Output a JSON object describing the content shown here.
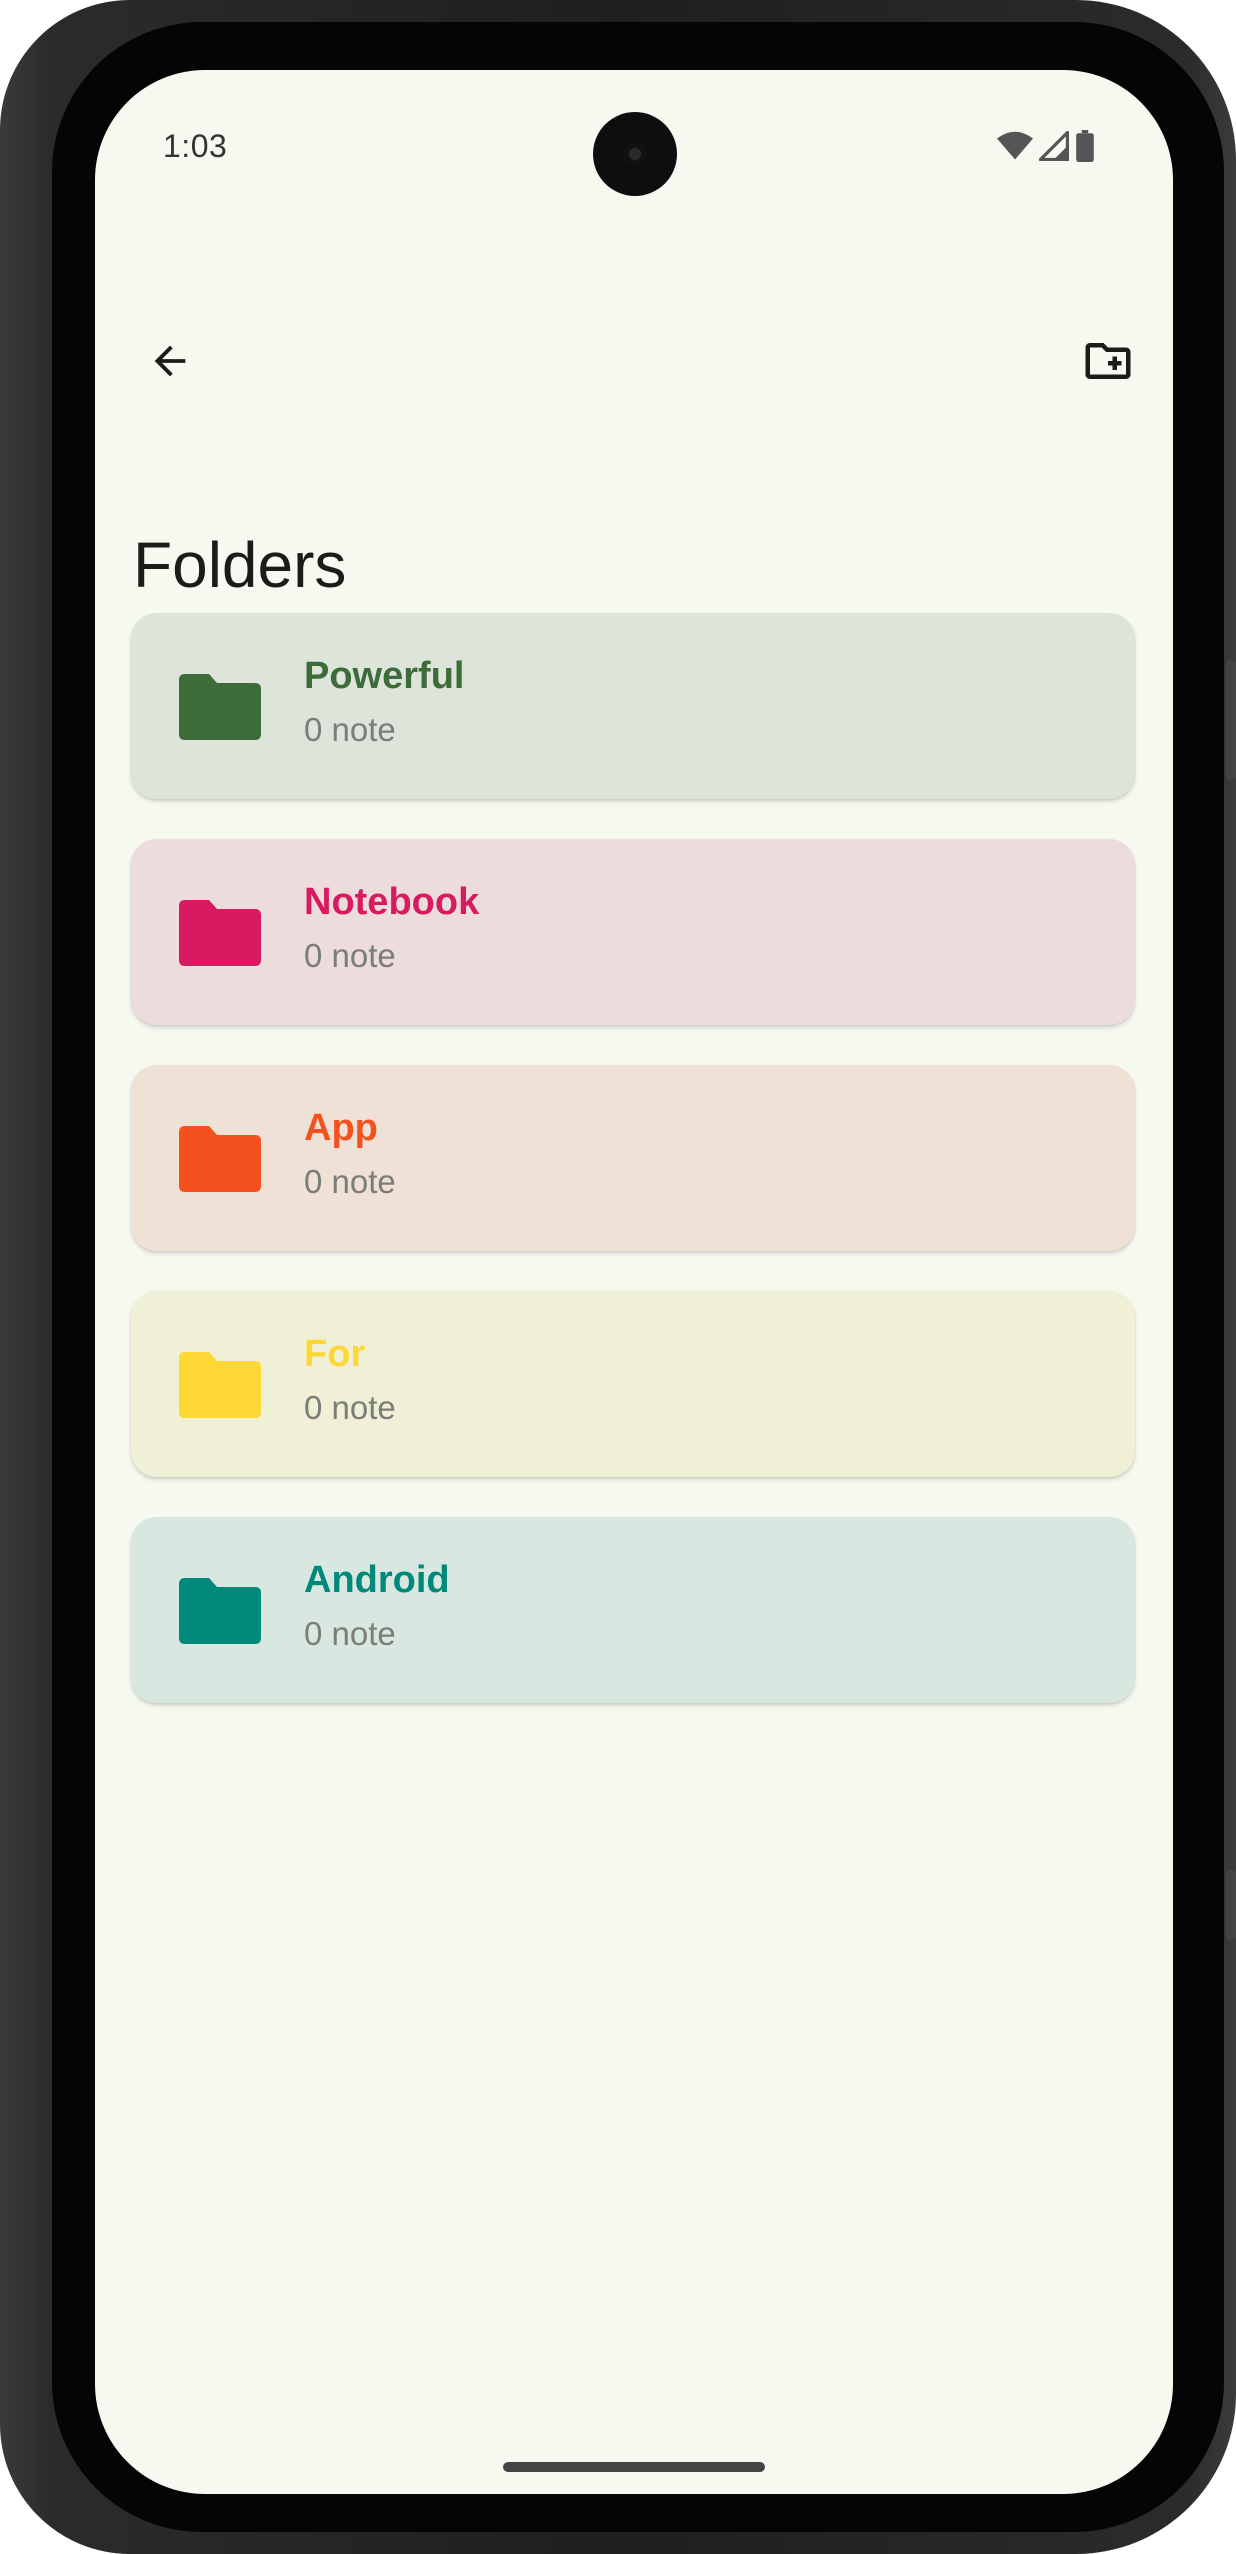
{
  "status_bar": {
    "time": "1:03",
    "icons": [
      "wifi-icon",
      "cellular-signal-icon",
      "battery-icon"
    ]
  },
  "app_bar": {
    "back_icon": "arrow-back-icon",
    "new_folder_icon": "create-new-folder-icon"
  },
  "page": {
    "title": "Folders"
  },
  "folders": [
    {
      "name": "Powerful",
      "count": "0 note",
      "color": "#3e6b3a",
      "bg": "#dde5da"
    },
    {
      "name": "Notebook",
      "count": "0 note",
      "color": "#d81b60",
      "bg": "#ecdcdc"
    },
    {
      "name": "App",
      "count": "0 note",
      "color": "#f4511e",
      "bg": "#f0e1d6"
    },
    {
      "name": "For",
      "count": "0 note",
      "color": "#fdd835",
      "bg": "#f0f0d6"
    },
    {
      "name": "Android",
      "count": "0 note",
      "color": "#00897b",
      "bg": "#d8e8e0"
    }
  ]
}
